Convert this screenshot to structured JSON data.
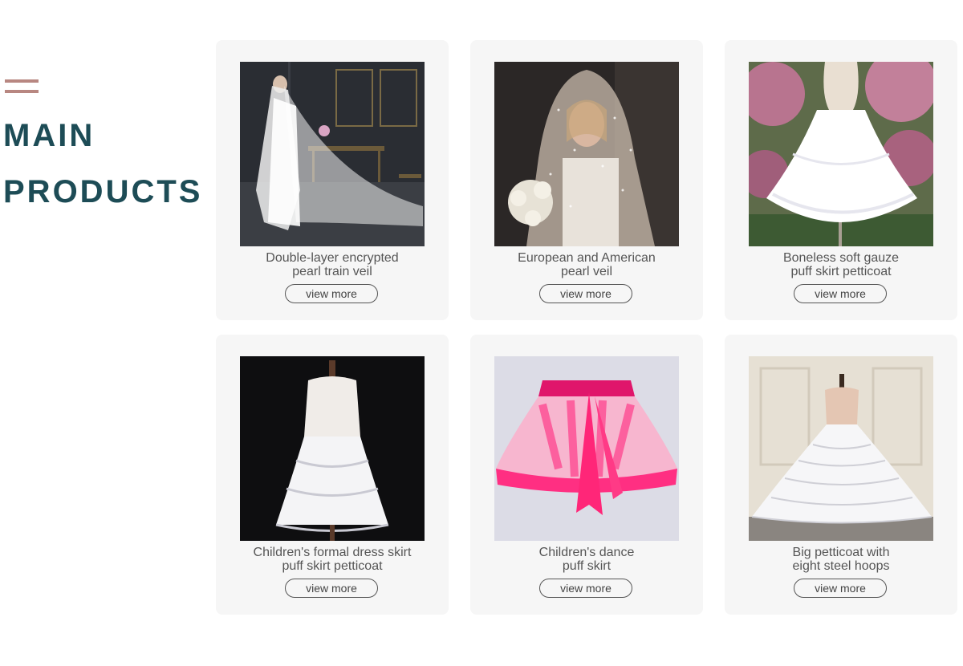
{
  "section": {
    "heading_line1": "MAIN",
    "heading_line2": "PRODUCTS",
    "accent_color": "#b88781",
    "heading_color": "#1d4c56"
  },
  "products": [
    {
      "title_line1": "Double-layer encrypted",
      "title_line2": "pearl train veil",
      "button_label": "view more",
      "image_icon": "bridal-veil-photo"
    },
    {
      "title_line1": "European and American",
      "title_line2": "pearl veil",
      "button_label": "view more",
      "image_icon": "pearl-veil-photo"
    },
    {
      "title_line1": "Boneless soft gauze",
      "title_line2": "puff skirt petticoat",
      "button_label": "view more",
      "image_icon": "petticoat-photo"
    },
    {
      "title_line1": "Children's formal dress skirt",
      "title_line2": "puff skirt petticoat",
      "button_label": "view more",
      "image_icon": "children-petticoat-photo"
    },
    {
      "title_line1": "Children's dance",
      "title_line2": "puff skirt",
      "button_label": "view more",
      "image_icon": "tutu-skirt-photo"
    },
    {
      "title_line1": "Big petticoat with",
      "title_line2": "eight steel hoops",
      "button_label": "view more",
      "image_icon": "hoop-petticoat-photo"
    }
  ]
}
